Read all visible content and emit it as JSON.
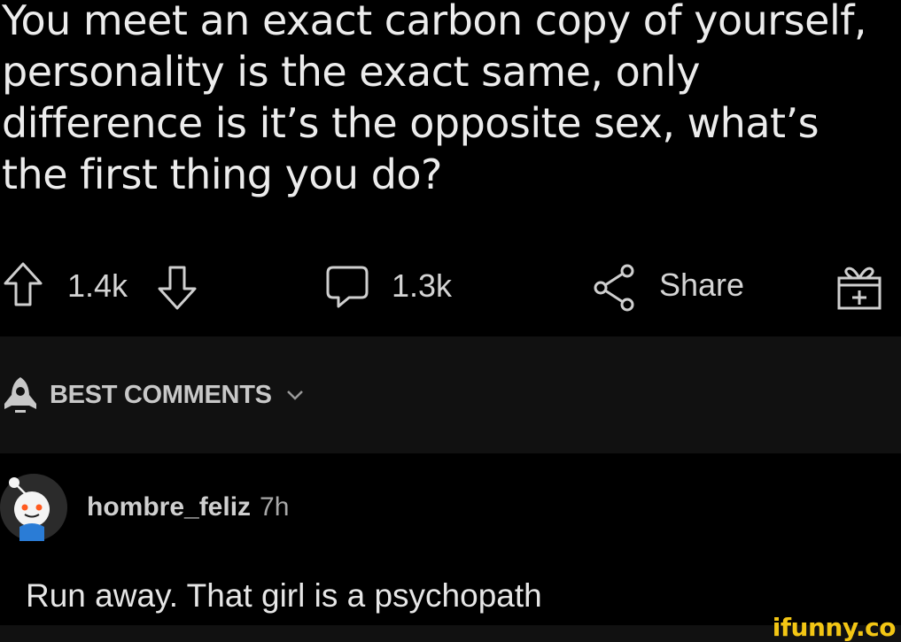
{
  "post": {
    "title": "You meet an exact carbon copy of yourself, personality is the exact same, only difference is it’s the opposite sex, what’s the first thing you do?"
  },
  "actions": {
    "upvote_icon": "arrow-up-icon",
    "score": "1.4k",
    "downvote_icon": "arrow-down-icon",
    "comment_icon": "comment-bubble-icon",
    "comment_count": "1.3k",
    "share_icon": "share-icon",
    "share_label": "Share",
    "award_icon": "gift-icon"
  },
  "sort": {
    "icon": "rocket-icon",
    "label": "BEST COMMENTS",
    "chevron": "chevron-down-icon"
  },
  "comment": {
    "username": "hombre_feliz",
    "age": "7h",
    "text": "Run away. That girl is a psychopath"
  },
  "watermark": {
    "text": "ifunny.co",
    "color": "#f3c614"
  },
  "colors": {
    "background": "#000000",
    "bar": "#111111",
    "text": "#ececec"
  }
}
